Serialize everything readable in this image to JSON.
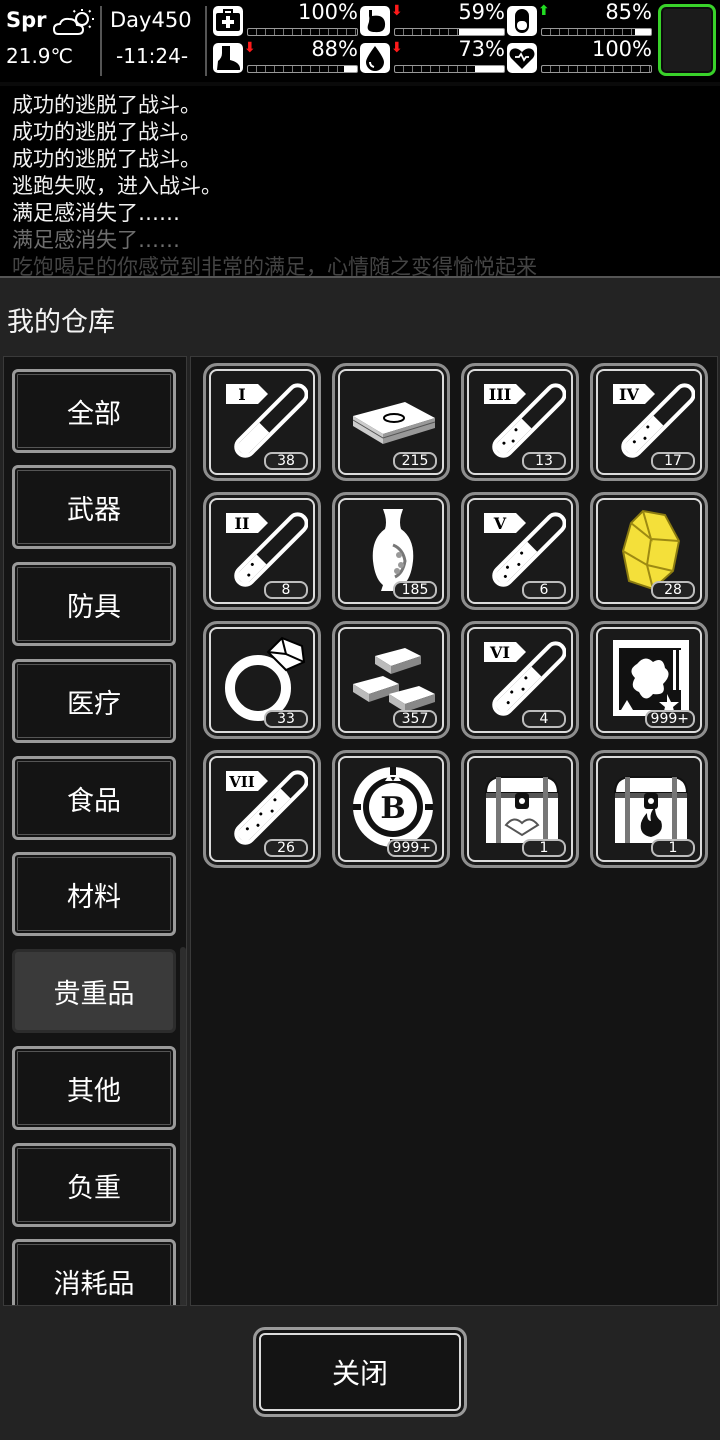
{
  "hud": {
    "season": "Spr",
    "weather_icon": "partly-cloudy-sun-icon",
    "temperature": "21.9℃",
    "day": "Day450",
    "time": "-11:24-",
    "stats": [
      {
        "icon": "health-kit-icon",
        "value": "100%",
        "level": 1.0,
        "arrow": ""
      },
      {
        "icon": "stomach-icon",
        "value": "59%",
        "level": 0.59,
        "arrow": "down"
      },
      {
        "icon": "pill-capsule-icon",
        "value": "85%",
        "level": 0.85,
        "arrow": "up"
      },
      {
        "icon": "foot-icon",
        "value": "88%",
        "level": 0.88,
        "arrow": "down"
      },
      {
        "icon": "water-drop-icon",
        "value": "73%",
        "level": 0.73,
        "arrow": "down"
      },
      {
        "icon": "heart-icon",
        "value": "100%",
        "level": 1.0,
        "arrow": ""
      }
    ],
    "slot_color": "#39d22a"
  },
  "log": {
    "lines": [
      "成功的逃脱了战斗。",
      "成功的逃脱了战斗。",
      "成功的逃脱了战斗。",
      "逃跑失败，进入战斗。",
      "满足感消失了……",
      "满足感消失了……",
      "吃饱喝足的你感觉到非常的满足，心情随之变得愉悦起来"
    ]
  },
  "panel": {
    "title": "我的仓库",
    "categories": [
      "全部",
      "武器",
      "防具",
      "医疗",
      "食品",
      "材料",
      "贵重品",
      "其他",
      "负重",
      "消耗品"
    ],
    "active_category": "贵重品",
    "close_label": "关闭"
  },
  "items": [
    {
      "icon": "test-tube-i-icon",
      "qty": "38"
    },
    {
      "icon": "cash-stack-icon",
      "qty": "215"
    },
    {
      "icon": "test-tube-iii-icon",
      "qty": "13"
    },
    {
      "icon": "test-tube-iv-icon",
      "qty": "17"
    },
    {
      "icon": "test-tube-ii-icon",
      "qty": "8"
    },
    {
      "icon": "vase-icon",
      "qty": "185"
    },
    {
      "icon": "test-tube-v-icon",
      "qty": "6"
    },
    {
      "icon": "gold-nugget-icon",
      "qty": "28"
    },
    {
      "icon": "diamond-ring-icon",
      "qty": "33"
    },
    {
      "icon": "gold-bars-icon",
      "qty": "357"
    },
    {
      "icon": "test-tube-vi-icon",
      "qty": "4"
    },
    {
      "icon": "painting-icon",
      "qty": "999+"
    },
    {
      "icon": "test-tube-vii-icon",
      "qty": "26"
    },
    {
      "icon": "b-coin-icon",
      "qty": "999+"
    },
    {
      "icon": "treasure-chest-icon",
      "qty": "1"
    },
    {
      "icon": "fire-chest-icon",
      "qty": "1"
    }
  ],
  "tube_labels": [
    "I",
    "III",
    "IV",
    "II",
    "V",
    "VI",
    "VII"
  ],
  "colors": {
    "accent_green": "#39d22a",
    "arrow_down": "#ff1a1a",
    "arrow_up": "#22dd22",
    "gold": "#f4e03a"
  }
}
